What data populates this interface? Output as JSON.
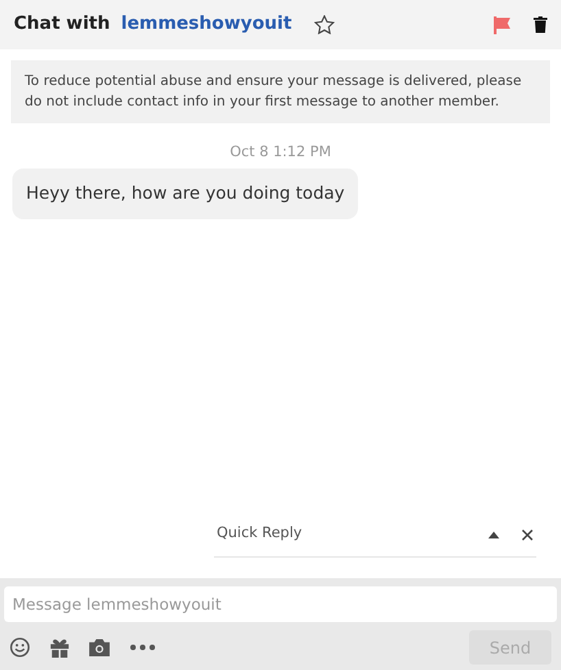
{
  "header": {
    "title": "Chat with",
    "username": "lemmeshowyouit",
    "starred": false
  },
  "notice": "To reduce potential abuse and ensure your message is delivered, please do not include contact info in your first message to another member.",
  "messages": [
    {
      "timestamp": "Oct 8 1:12 PM",
      "text": "Heyy there, how are you doing today"
    }
  ],
  "quick_reply": {
    "label": "Quick Reply",
    "expanded": false
  },
  "composer": {
    "placeholder": "Message lemmeshowyouit",
    "send": {
      "label": "Send",
      "disabled": true
    }
  }
}
